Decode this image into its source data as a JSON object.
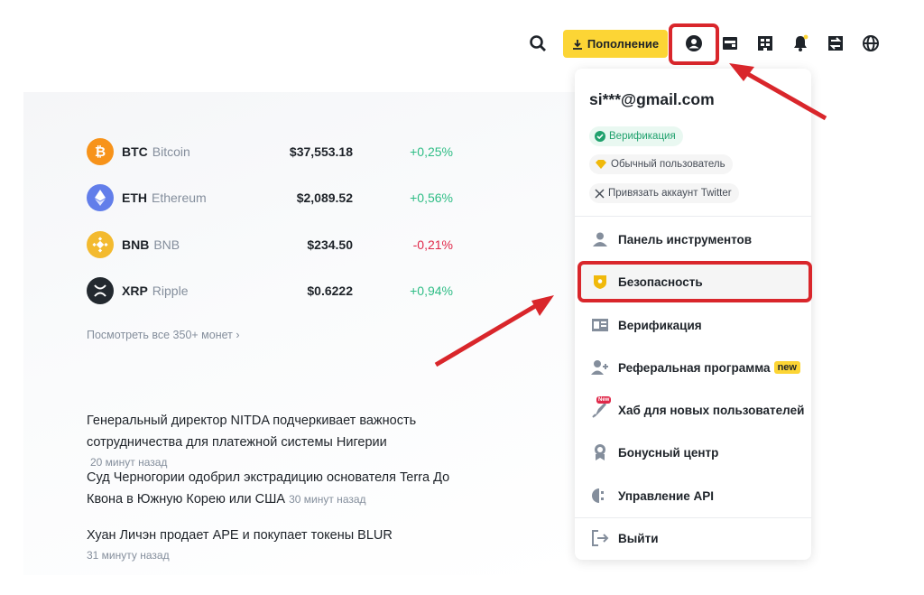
{
  "topbar": {
    "deposit_label": "Пополнение",
    "icons": [
      "search-icon",
      "download-icon",
      "user-icon",
      "wallet-icon",
      "orders-icon",
      "bell-icon",
      "exchange-icon",
      "globe-icon"
    ]
  },
  "coins": [
    {
      "symbol": "BTC",
      "name": "Bitcoin",
      "price": "$37,553.18",
      "change": "+0,25%",
      "color": "#f7931a",
      "trend": "up"
    },
    {
      "symbol": "ETH",
      "name": "Ethereum",
      "price": "$2,089.52",
      "change": "+0,56%",
      "color": "#627eea",
      "trend": "up"
    },
    {
      "symbol": "BNB",
      "name": "BNB",
      "price": "$234.50",
      "change": "-0,21%",
      "color": "#f3ba2f",
      "trend": "down"
    },
    {
      "symbol": "XRP",
      "name": "Ripple",
      "price": "$0.6222",
      "change": "+0,94%",
      "color": "#23292f",
      "trend": "up"
    }
  ],
  "view_all": "Посмотреть все 350+ монет",
  "news": [
    {
      "title": "Генеральный директор NITDA подчеркивает важность сотрудничества для платежной системы Нигерии",
      "time": "20 минут назад"
    },
    {
      "title": "Суд Черногории одобрил экстрадицию основателя Terra До Квона в Южную Корею или США",
      "time": "30 минут назад"
    },
    {
      "title": "Хуан Личэн продает APE и покупает токены BLUR",
      "time": "31 минуту назад"
    }
  ],
  "dropdown": {
    "email": "si***@gmail.com",
    "tags": [
      "Верификация",
      "Обычный пользователь",
      "Привязать аккаунт Twitter"
    ],
    "items": [
      {
        "label": "Панель инструментов",
        "icon": "dashboard-user-icon"
      },
      {
        "label": "Безопасность",
        "icon": "shield-icon"
      },
      {
        "label": "Верификация",
        "icon": "id-card-icon"
      },
      {
        "label": "Реферальная программа",
        "icon": "add-user-icon",
        "badge": "new"
      },
      {
        "label": "Хаб для новых пользователей",
        "icon": "rocket-icon",
        "badge_small": "New"
      },
      {
        "label": "Бонусный центр",
        "icon": "medal-icon"
      },
      {
        "label": "Управление API",
        "icon": "api-icon"
      },
      {
        "label": "Выйти",
        "icon": "logout-icon"
      }
    ]
  },
  "colors": {
    "accent": "#fcd535",
    "highlight": "#d9262b",
    "positive": "#2ebd85",
    "negative": "#e0294a"
  }
}
